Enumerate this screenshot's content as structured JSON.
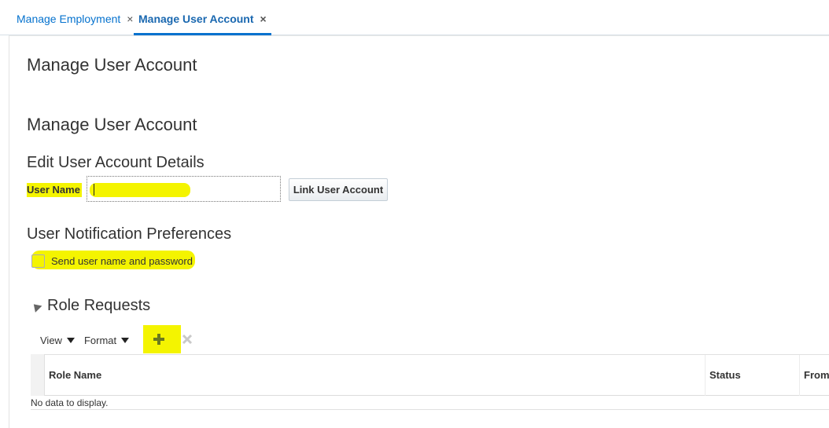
{
  "tabs": [
    {
      "label": "Manage Employment",
      "close": "×"
    },
    {
      "label": "Manage User Account",
      "close": "×"
    }
  ],
  "page": {
    "title": "Manage User Account",
    "subtitle": "Manage User Account"
  },
  "edit_details": {
    "heading": "Edit User Account Details",
    "user_name_label": "User Name",
    "user_name_value": "",
    "link_button": "Link User Account"
  },
  "notifications": {
    "heading": "User Notification Preferences",
    "send_checkbox_label": "Send user name and password",
    "send_checked": false
  },
  "role_requests": {
    "heading": "Role Requests",
    "toolbar": {
      "view": "View",
      "format": "Format"
    },
    "columns": [
      "Role Name",
      "Status",
      "From"
    ],
    "empty_text": "No data to display."
  },
  "colors": {
    "accent": "#0572ce",
    "highlight": "#f4f400"
  }
}
